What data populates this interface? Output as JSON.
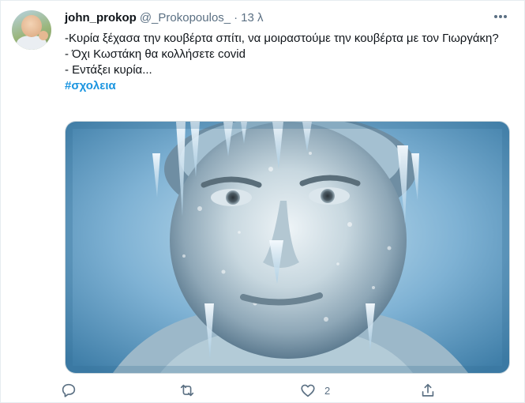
{
  "tweet": {
    "author": {
      "name": "john_prokop",
      "handle": "@_Prokopoulos_",
      "separator": "·",
      "time": "13 λ"
    },
    "text_lines": [
      "-Κυρία ξέχασα την κουβέρτα σπίτι, να μοιραστούμε την κουβέρτα με τον Γιωργάκη?",
      "- Όχι Κωστάκη θα κολλήσετε covid",
      "- Εντάξει κυρία..."
    ],
    "hashtag": "#σχολεια",
    "actions": {
      "reply_count": "",
      "retweet_count": "",
      "like_count": "2",
      "share_count": ""
    }
  },
  "icons": {
    "more": "more-icon",
    "reply": "reply-icon",
    "retweet": "retweet-icon",
    "like": "heart-icon",
    "share": "share-icon"
  },
  "colors": {
    "text_primary": "#0f1419",
    "text_secondary": "#5b7083",
    "hashtag": "#1b95e0",
    "border": "#e6ecf0"
  }
}
